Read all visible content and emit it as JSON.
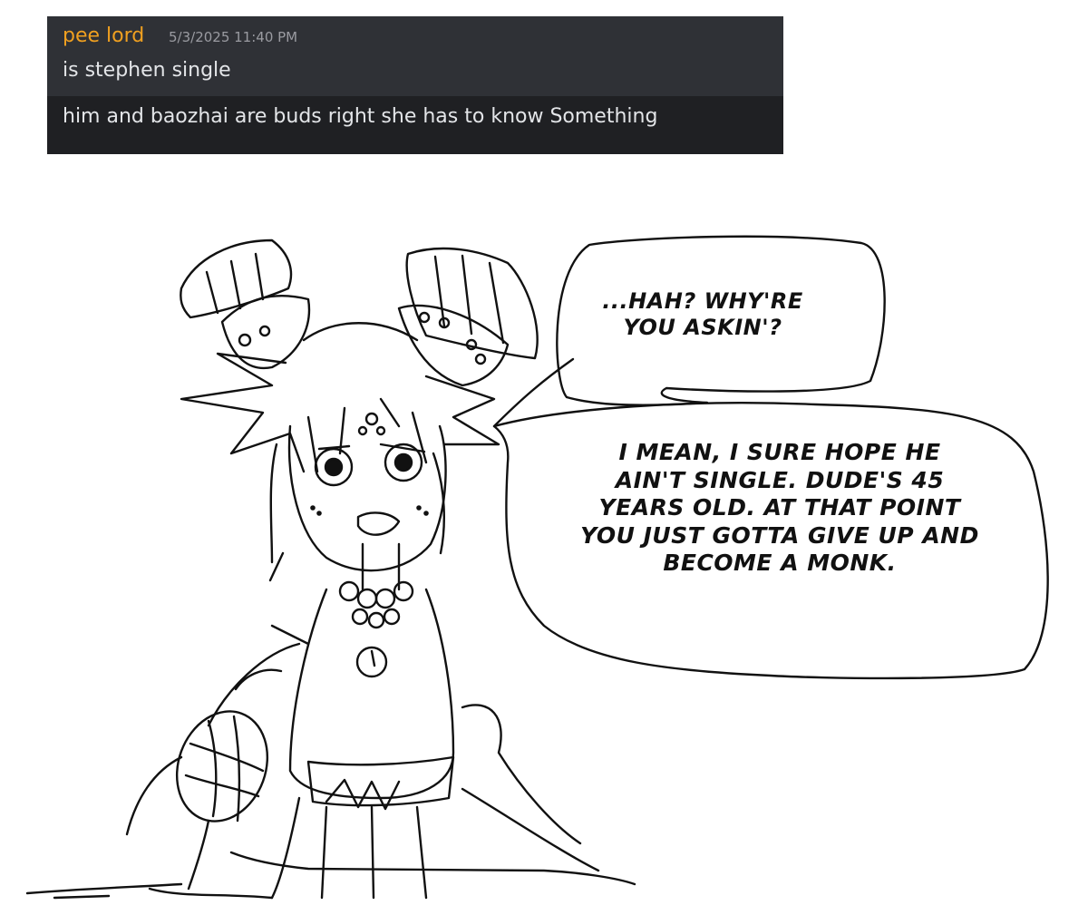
{
  "chat": {
    "username": "pee lord",
    "timestamp": "5/3/2025 11:40 PM",
    "messages": [
      "is stephen single",
      "him and baozhai are buds right she has to know Something"
    ],
    "colors": {
      "username": "#f0a020",
      "background": "#2f3136",
      "background_dark": "#1f2023",
      "text": "#e3e5e8",
      "timestamp": "#9a9ba1"
    }
  },
  "comic": {
    "speech_1": "...HAH? WHY'RE\nYOU ASKIN'?",
    "speech_2": "I MEAN, I SURE HOPE HE\nAIN'T SINGLE. DUDE'S 45\nYEARS OLD. AT THAT POINT\nYOU JUST GOTTA GIVE UP AND\nBECOME A MONK."
  }
}
